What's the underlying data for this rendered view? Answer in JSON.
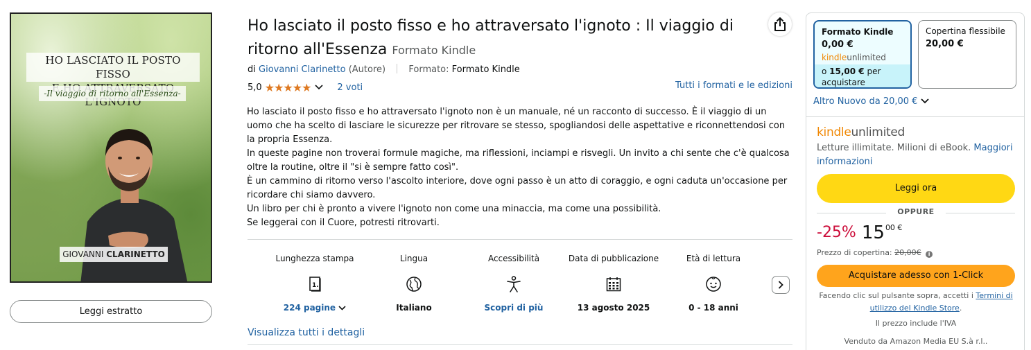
{
  "cover": {
    "title_line1": "HO LASCIATO IL POSTO FISSO",
    "title_line2": "E HO ATTRAVERSATO L'IGNOTO",
    "subtitle": "-Il viaggio di ritorno all'Essenza-",
    "author_first": "GIOVANNI",
    "author_last": "CLARINETTO"
  },
  "read_sample_label": "Leggi estratto",
  "product": {
    "title": "Ho lasciato il posto fisso e ho attraversato l'ignoto : Il viaggio di ritorno all'Essenza",
    "format_suffix": "Formato Kindle",
    "by": "di",
    "author": "Giovanni Clarinetto",
    "author_role": "(Autore)",
    "format_label": "Formato:",
    "format_value": "Formato Kindle",
    "rating_value": "5,0",
    "rating_stars": 5,
    "ratings_count": "2 voti",
    "all_formats_link": "Tutti i formati e le edizioni"
  },
  "description": [
    "Ho lasciato il posto fisso e ho attraversato l'ignoto non è un manuale, né un racconto di successo. È il viaggio di un uomo che ha scelto di lasciare le sicurezze per ritrovare se stesso, spogliandosi delle aspettative e riconnettendosi con la propria Essenza.",
    "In queste pagine non troverai formule magiche, ma riflessioni, inciampi e risvegli. Un invito a chi sente che c'è qualcosa oltre la routine, oltre il \"si è sempre fatto così\".",
    "È un cammino di ritorno verso l'ascolto interiore, dove ogni passo è un atto di coraggio, e ogni caduta un'occasione per ricordare chi siamo davvero.",
    "Un libro per chi è pronto a vivere l'ignoto non come una minaccia, ma come una possibilità.",
    "Se leggerai con il Cuore, potresti ritrovarti."
  ],
  "details": [
    {
      "label": "Lunghezza stampa",
      "value": "224 pagine",
      "icon": "book-pages-icon",
      "link": true,
      "chevron": true
    },
    {
      "label": "Lingua",
      "value": "Italiano",
      "icon": "globe-icon",
      "link": false
    },
    {
      "label": "Accessibilità",
      "value": "Scopri di più",
      "icon": "accessibility-icon",
      "link": true
    },
    {
      "label": "Data di pubblicazione",
      "value": "13 agosto 2025",
      "icon": "calendar-icon",
      "link": false
    },
    {
      "label": "Età di lettura",
      "value": "0 - 18 anni",
      "icon": "child-face-icon",
      "link": false
    }
  ],
  "view_all_details": "Visualizza tutti i dettagli",
  "buybox": {
    "formats": [
      {
        "name": "Formato Kindle",
        "price": "0,00 €",
        "ku_k": "kindle",
        "ku_u": "unlimited",
        "or_text": "o",
        "or_price": "15,00 €",
        "or_suffix": "per acquistare",
        "selected": true
      },
      {
        "name": "Copertina flessibile",
        "price": "20,00 €",
        "selected": false
      }
    ],
    "other_new_prefix": "Altro Nuovo da",
    "other_new_price": "20,00 €",
    "ku_logo_k": "kindle",
    "ku_logo_u": "unlimited",
    "ku_text": "Letture illimitate. Milioni di eBook.",
    "ku_more_link": "Maggiori informazioni",
    "read_now": "Leggi ora",
    "or_divider": "OPPURE",
    "discount": "-25%",
    "price_int": "15",
    "price_dec": "00 €",
    "list_price_label": "Prezzo di copertina:",
    "list_price": "20,00€",
    "one_click": "Acquistare adesso con 1-Click",
    "terms_prefix": "Facendo clic sul pulsante sopra, accetti i",
    "terms_link": "Termini di utilizzo del Kindle Store",
    "terms_suffix": ".",
    "vat_note": "Il prezzo include l'IVA",
    "sold_by": "Venduto da Amazon Media EU S.à r.l.."
  },
  "colors": {
    "link": "#2162a1",
    "star": "#de7921",
    "yellow_button": "#ffd814",
    "orange_button": "#ffa41c",
    "discount": "#cc0c39",
    "selected_border": "#2162a1",
    "kindle_orange": "#f08804"
  }
}
